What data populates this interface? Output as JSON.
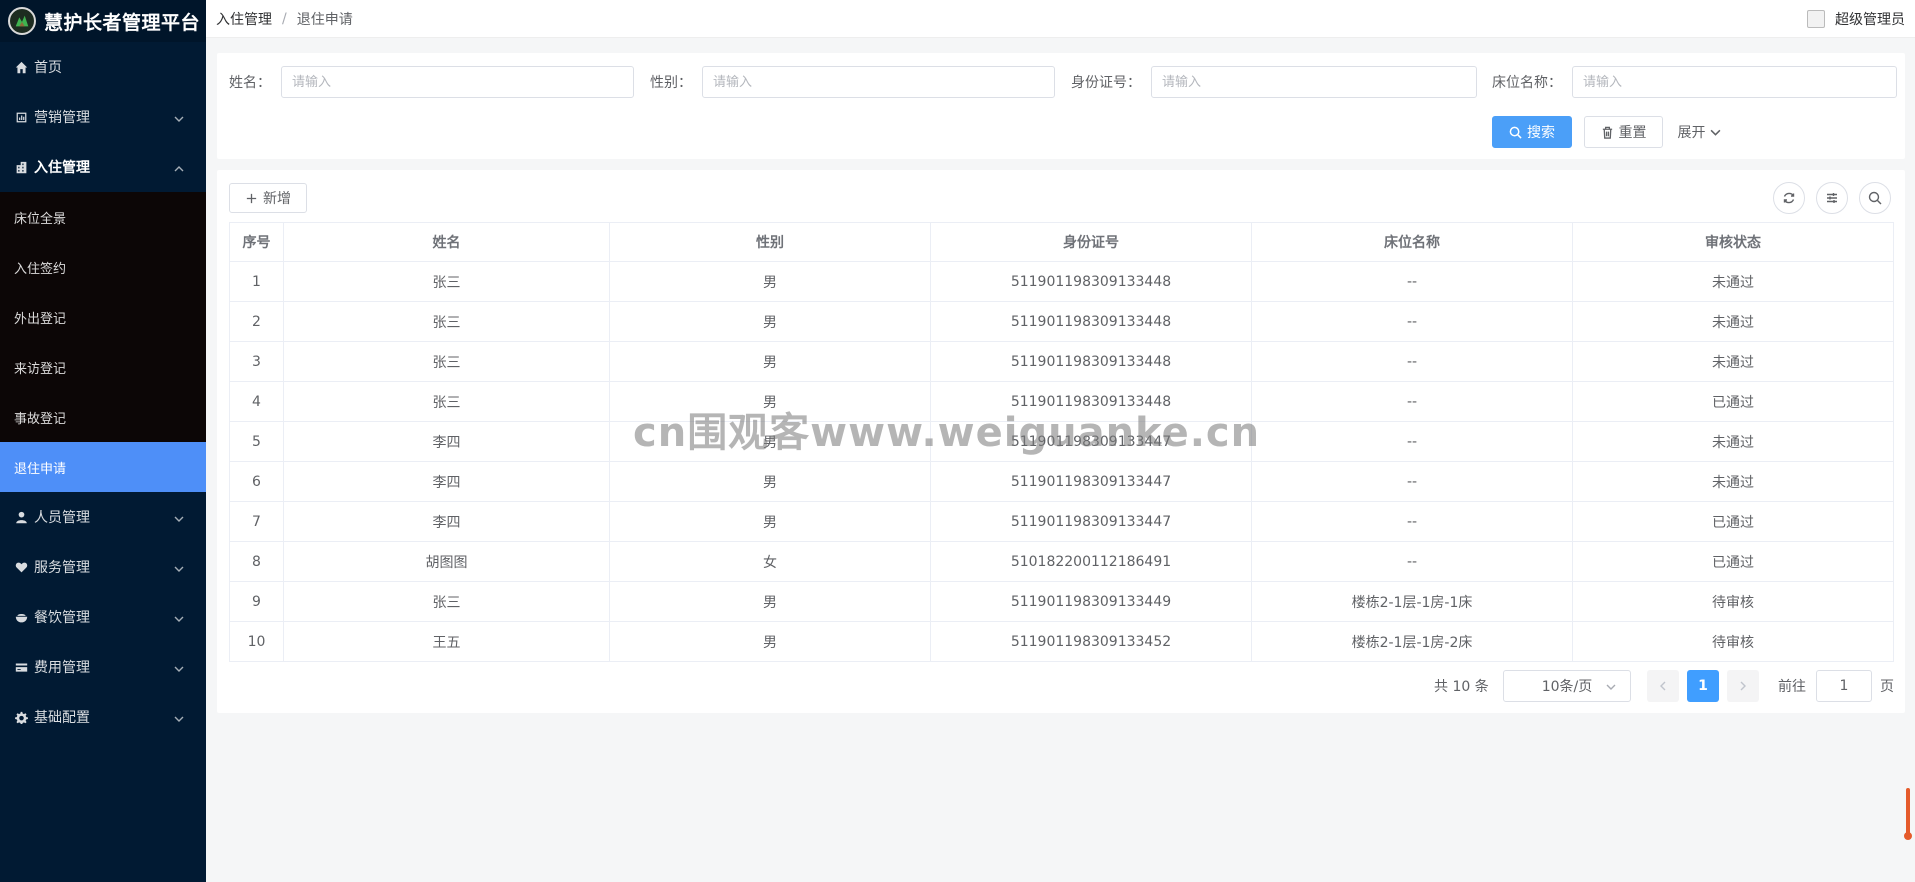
{
  "app": {
    "title": "慧护长者管理平台"
  },
  "sidebar": {
    "items": [
      {
        "label": "首页",
        "icon": "home-icon"
      },
      {
        "label": "营销管理",
        "icon": "chart-icon"
      },
      {
        "label": "入住管理",
        "icon": "building-icon"
      },
      {
        "label": "人员管理",
        "icon": "user-icon"
      },
      {
        "label": "服务管理",
        "icon": "heart-hand-icon"
      },
      {
        "label": "餐饮管理",
        "icon": "bowl-icon"
      },
      {
        "label": "费用管理",
        "icon": "card-icon"
      },
      {
        "label": "基础配置",
        "icon": "gear-icon"
      }
    ],
    "submenu": [
      "床位全景",
      "入住签约",
      "外出登记",
      "来访登记",
      "事故登记",
      "退住申请"
    ]
  },
  "header": {
    "breadcrumb": [
      "入住管理",
      "退住申请"
    ],
    "separator": "/",
    "user": "超级管理员"
  },
  "search": {
    "fields": [
      {
        "label": "姓名：",
        "placeholder": "请输入"
      },
      {
        "label": "性别：",
        "placeholder": "请输入"
      },
      {
        "label": "身份证号：",
        "placeholder": "请输入"
      },
      {
        "label": "床位名称：",
        "placeholder": "请输入"
      }
    ],
    "search_label": "搜索",
    "reset_label": "重置",
    "expand_label": "展开"
  },
  "toolbar": {
    "add_label": "新增"
  },
  "table": {
    "columns": [
      "序号",
      "姓名",
      "性别",
      "身份证号",
      "床位名称",
      "审核状态"
    ],
    "rows": [
      [
        "1",
        "张三",
        "男",
        "511901198309133448",
        "--",
        "未通过"
      ],
      [
        "2",
        "张三",
        "男",
        "511901198309133448",
        "--",
        "未通过"
      ],
      [
        "3",
        "张三",
        "男",
        "511901198309133448",
        "--",
        "未通过"
      ],
      [
        "4",
        "张三",
        "男",
        "511901198309133448",
        "--",
        "已通过"
      ],
      [
        "5",
        "李四",
        "男",
        "511901198309133447",
        "--",
        "未通过"
      ],
      [
        "6",
        "李四",
        "男",
        "511901198309133447",
        "--",
        "未通过"
      ],
      [
        "7",
        "李四",
        "男",
        "511901198309133447",
        "--",
        "已通过"
      ],
      [
        "8",
        "胡图图",
        "女",
        "510182200112186491",
        "--",
        "已通过"
      ],
      [
        "9",
        "张三",
        "男",
        "511901198309133449",
        "楼栋2-1层-1房-1床",
        "待审核"
      ],
      [
        "10",
        "王五",
        "男",
        "511901198309133452",
        "楼栋2-1层-1房-2床",
        "待审核"
      ]
    ]
  },
  "pagination": {
    "total": "共 10 条",
    "page_size": "10条/页",
    "current_page": "1",
    "goto_label": "前往",
    "goto_value": "1",
    "page_suffix": "页"
  },
  "watermark": "cn围观客www.weiguanke.cn",
  "colors": {
    "sidebar_bg": "#011a33",
    "active": "#4e8ff8",
    "primary": "#409eff"
  }
}
